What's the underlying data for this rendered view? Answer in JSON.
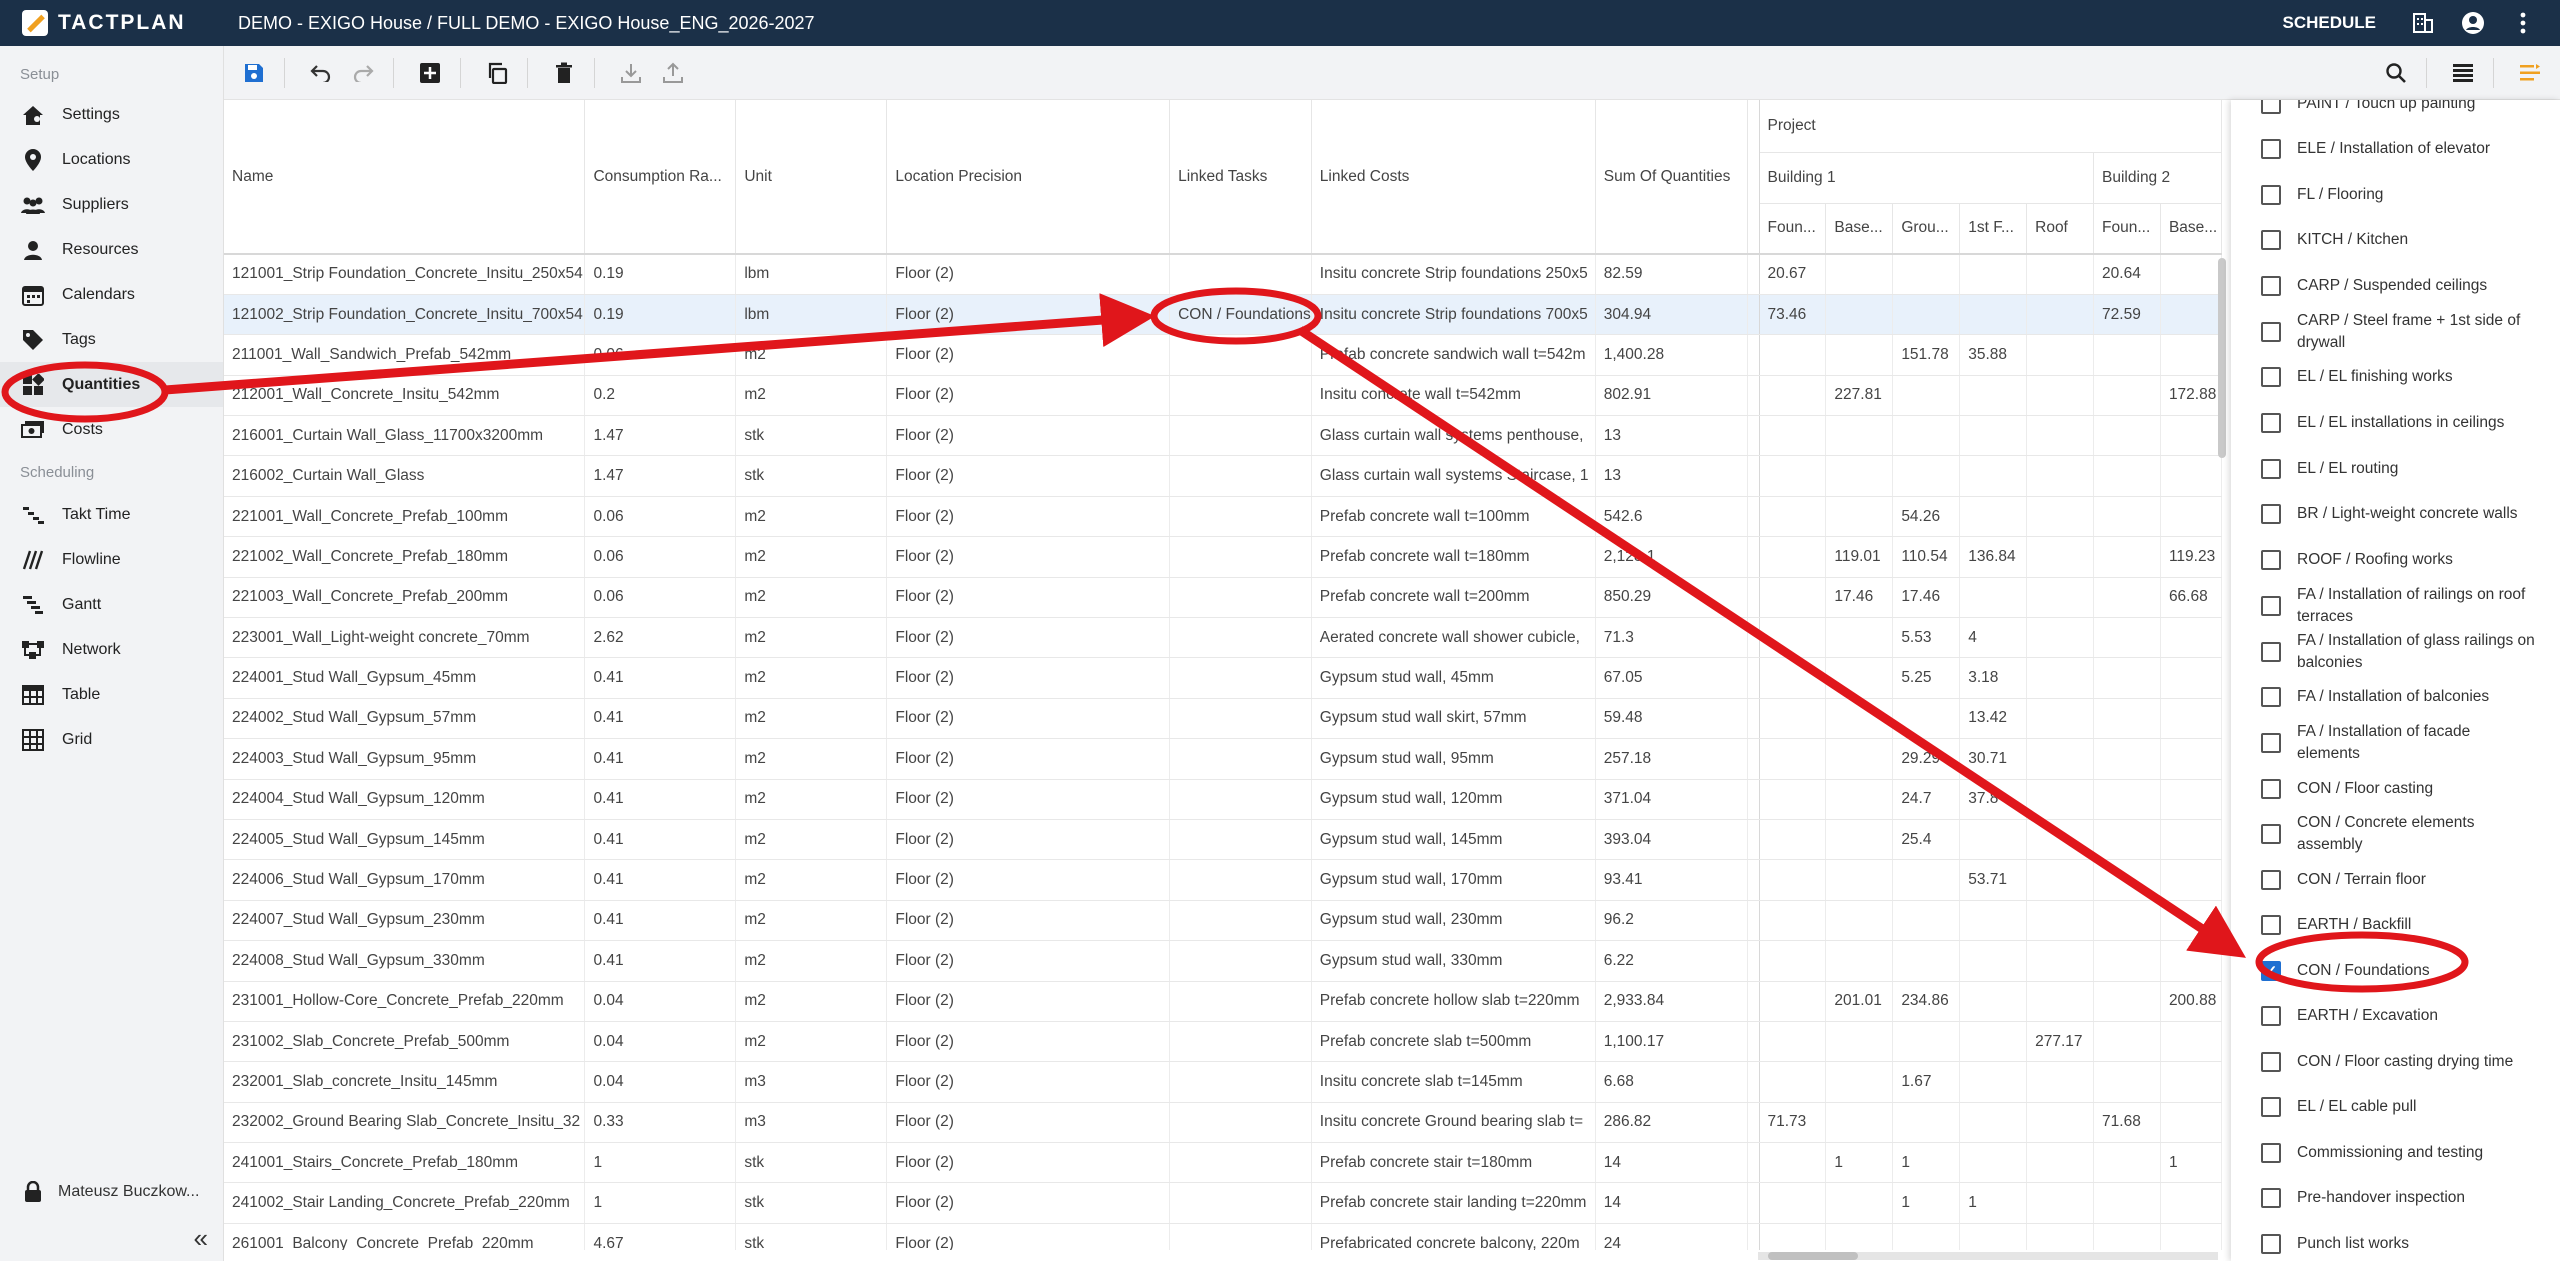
{
  "topbar": {
    "logo_text": "TACTPLAN",
    "project_title": "DEMO - EXIGO House / FULL DEMO - EXIGO House_ENG_2026-2027",
    "schedule_label": "SCHEDULE"
  },
  "sidebar": {
    "setup_label": "Setup",
    "setup_items": [
      {
        "label": "Settings",
        "icon": "home-gear-icon"
      },
      {
        "label": "Locations",
        "icon": "location-pin-icon"
      },
      {
        "label": "Suppliers",
        "icon": "people-icon"
      },
      {
        "label": "Resources",
        "icon": "person-icon"
      },
      {
        "label": "Calendars",
        "icon": "calendar-icon"
      },
      {
        "label": "Tags",
        "icon": "tag-icon"
      },
      {
        "label": "Quantities",
        "icon": "quantities-icon",
        "active": true
      },
      {
        "label": "Costs",
        "icon": "money-icon"
      }
    ],
    "scheduling_label": "Scheduling",
    "scheduling_items": [
      {
        "label": "Takt Time",
        "icon": "takt-icon"
      },
      {
        "label": "Flowline",
        "icon": "flowline-icon"
      },
      {
        "label": "Gantt",
        "icon": "gantt-icon"
      },
      {
        "label": "Network",
        "icon": "network-icon"
      },
      {
        "label": "Table",
        "icon": "table-icon"
      },
      {
        "label": "Grid",
        "icon": "grid-icon"
      }
    ],
    "user_name": "Mateusz Buczkow...",
    "collapse_glyph": "«"
  },
  "table": {
    "headers": {
      "name": "Name",
      "consumption_rate": "Consumption Ra...",
      "unit": "Unit",
      "location_precision": "Location Precision",
      "linked_tasks": "Linked Tasks",
      "linked_costs": "Linked Costs",
      "sum_of_quantities": "Sum Of Quantities",
      "project": "Project",
      "building1": "Building 1",
      "building2": "Building 2",
      "b1_cols": [
        "Foun...",
        "Base...",
        "Grou...",
        "1st F...",
        "Roof"
      ],
      "b2_cols": [
        "Foun...",
        "Base..."
      ]
    },
    "rows": [
      {
        "name": "121001_Strip Foundation_Concrete_Insitu_250x54",
        "rate": "0.19",
        "unit": "lbm",
        "loc": "Floor (2)",
        "tasks": "",
        "costs": "Insitu concrete Strip foundations 250x5",
        "sum": "82.59",
        "b1": [
          "20.67",
          "",
          "",
          "",
          ""
        ],
        "b2": [
          "20.64",
          ""
        ]
      },
      {
        "name": "121002_Strip Foundation_Concrete_Insitu_700x54",
        "rate": "0.19",
        "unit": "lbm",
        "loc": "Floor (2)",
        "tasks": "CON / Foundations",
        "costs": "Insitu concrete Strip foundations 700x5",
        "sum": "304.94",
        "b1": [
          "73.46",
          "",
          "",
          "",
          ""
        ],
        "b2": [
          "72.59",
          ""
        ],
        "selected": true
      },
      {
        "name": "211001_Wall_Sandwich_Prefab_542mm",
        "rate": "0.06",
        "unit": "m2",
        "loc": "Floor (2)",
        "tasks": "",
        "costs": "Prefab concrete sandwich wall t=542m",
        "sum": "1,400.28",
        "b1": [
          "",
          "",
          "151.78",
          "35.88",
          ""
        ],
        "b2": [
          "",
          ""
        ]
      },
      {
        "name": "212001_Wall_Concrete_Insitu_542mm",
        "rate": "0.2",
        "unit": "m2",
        "loc": "Floor (2)",
        "tasks": "",
        "costs": "Insitu concrete wall t=542mm",
        "sum": "802.91",
        "b1": [
          "",
          "227.81",
          "",
          "",
          ""
        ],
        "b2": [
          "",
          "172.88"
        ]
      },
      {
        "name": "216001_Curtain Wall_Glass_11700x3200mm",
        "rate": "1.47",
        "unit": "stk",
        "loc": "Floor (2)",
        "tasks": "",
        "costs": "Glass curtain wall systems penthouse,",
        "sum": "13",
        "b1": [
          "",
          "",
          "",
          "",
          ""
        ],
        "b2": [
          "",
          ""
        ]
      },
      {
        "name": "216002_Curtain Wall_Glass",
        "rate": "1.47",
        "unit": "stk",
        "loc": "Floor (2)",
        "tasks": "",
        "costs": "Glass curtain wall systems Staircase, 1",
        "sum": "13",
        "b1": [
          "",
          "",
          "",
          "",
          ""
        ],
        "b2": [
          "",
          ""
        ]
      },
      {
        "name": "221001_Wall_Concrete_Prefab_100mm",
        "rate": "0.06",
        "unit": "m2",
        "loc": "Floor (2)",
        "tasks": "",
        "costs": "Prefab concrete wall t=100mm",
        "sum": "542.6",
        "b1": [
          "",
          "",
          "54.26",
          "",
          ""
        ],
        "b2": [
          "",
          ""
        ]
      },
      {
        "name": "221002_Wall_Concrete_Prefab_180mm",
        "rate": "0.06",
        "unit": "m2",
        "loc": "Floor (2)",
        "tasks": "",
        "costs": "Prefab concrete wall t=180mm",
        "sum": "2,128.1",
        "b1": [
          "",
          "119.01",
          "110.54",
          "136.84",
          ""
        ],
        "b2": [
          "",
          "119.23"
        ]
      },
      {
        "name": "221003_Wall_Concrete_Prefab_200mm",
        "rate": "0.06",
        "unit": "m2",
        "loc": "Floor (2)",
        "tasks": "",
        "costs": "Prefab concrete wall t=200mm",
        "sum": "850.29",
        "b1": [
          "",
          "17.46",
          "17.46",
          "",
          ""
        ],
        "b2": [
          "",
          "66.68"
        ]
      },
      {
        "name": "223001_Wall_Light-weight concrete_70mm",
        "rate": "2.62",
        "unit": "m2",
        "loc": "Floor (2)",
        "tasks": "",
        "costs": "Aerated concrete wall shower cubicle,",
        "sum": "71.3",
        "b1": [
          "",
          "",
          "5.53",
          "4",
          ""
        ],
        "b2": [
          "",
          ""
        ]
      },
      {
        "name": "224001_Stud Wall_Gypsum_45mm",
        "rate": "0.41",
        "unit": "m2",
        "loc": "Floor (2)",
        "tasks": "",
        "costs": "Gypsum stud wall, 45mm",
        "sum": "67.05",
        "b1": [
          "",
          "",
          "5.25",
          "3.18",
          ""
        ],
        "b2": [
          "",
          ""
        ]
      },
      {
        "name": "224002_Stud Wall_Gypsum_57mm",
        "rate": "0.41",
        "unit": "m2",
        "loc": "Floor (2)",
        "tasks": "",
        "costs": "Gypsum stud wall skirt, 57mm",
        "sum": "59.48",
        "b1": [
          "",
          "",
          "",
          "13.42",
          ""
        ],
        "b2": [
          "",
          ""
        ]
      },
      {
        "name": "224003_Stud Wall_Gypsum_95mm",
        "rate": "0.41",
        "unit": "m2",
        "loc": "Floor (2)",
        "tasks": "",
        "costs": "Gypsum stud wall, 95mm",
        "sum": "257.18",
        "b1": [
          "",
          "",
          "29.29",
          "30.71",
          ""
        ],
        "b2": [
          "",
          ""
        ]
      },
      {
        "name": "224004_Stud Wall_Gypsum_120mm",
        "rate": "0.41",
        "unit": "m2",
        "loc": "Floor (2)",
        "tasks": "",
        "costs": "Gypsum stud wall, 120mm",
        "sum": "371.04",
        "b1": [
          "",
          "",
          "24.7",
          "37.8",
          ""
        ],
        "b2": [
          "",
          ""
        ]
      },
      {
        "name": "224005_Stud Wall_Gypsum_145mm",
        "rate": "0.41",
        "unit": "m2",
        "loc": "Floor (2)",
        "tasks": "",
        "costs": "Gypsum stud wall, 145mm",
        "sum": "393.04",
        "b1": [
          "",
          "",
          "25.4",
          "",
          ""
        ],
        "b2": [
          "",
          ""
        ]
      },
      {
        "name": "224006_Stud Wall_Gypsum_170mm",
        "rate": "0.41",
        "unit": "m2",
        "loc": "Floor (2)",
        "tasks": "",
        "costs": "Gypsum stud wall, 170mm",
        "sum": "93.41",
        "b1": [
          "",
          "",
          "",
          "53.71",
          ""
        ],
        "b2": [
          "",
          ""
        ]
      },
      {
        "name": "224007_Stud Wall_Gypsum_230mm",
        "rate": "0.41",
        "unit": "m2",
        "loc": "Floor (2)",
        "tasks": "",
        "costs": "Gypsum stud wall, 230mm",
        "sum": "96.2",
        "b1": [
          "",
          "",
          "",
          "",
          ""
        ],
        "b2": [
          "",
          ""
        ]
      },
      {
        "name": "224008_Stud Wall_Gypsum_330mm",
        "rate": "0.41",
        "unit": "m2",
        "loc": "Floor (2)",
        "tasks": "",
        "costs": "Gypsum stud wall, 330mm",
        "sum": "6.22",
        "b1": [
          "",
          "",
          "",
          "",
          ""
        ],
        "b2": [
          "",
          ""
        ]
      },
      {
        "name": "231001_Hollow-Core_Concrete_Prefab_220mm",
        "rate": "0.04",
        "unit": "m2",
        "loc": "Floor (2)",
        "tasks": "",
        "costs": "Prefab concrete hollow slab t=220mm",
        "sum": "2,933.84",
        "b1": [
          "",
          "201.01",
          "234.86",
          "",
          ""
        ],
        "b2": [
          "",
          "200.88"
        ]
      },
      {
        "name": "231002_Slab_Concrete_Prefab_500mm",
        "rate": "0.04",
        "unit": "m2",
        "loc": "Floor (2)",
        "tasks": "",
        "costs": "Prefab concrete slab t=500mm",
        "sum": "1,100.17",
        "b1": [
          "",
          "",
          "",
          "",
          "277.17"
        ],
        "b2": [
          "",
          ""
        ]
      },
      {
        "name": "232001_Slab_concrete_Insitu_145mm",
        "rate": "0.04",
        "unit": "m3",
        "loc": "Floor (2)",
        "tasks": "",
        "costs": "Insitu concrete slab t=145mm",
        "sum": "6.68",
        "b1": [
          "",
          "",
          "1.67",
          "",
          ""
        ],
        "b2": [
          "",
          ""
        ]
      },
      {
        "name": "232002_Ground Bearing Slab_Concrete_Insitu_32",
        "rate": "0.33",
        "unit": "m3",
        "loc": "Floor (2)",
        "tasks": "",
        "costs": "Insitu concrete Ground bearing slab t=",
        "sum": "286.82",
        "b1": [
          "71.73",
          "",
          "",
          "",
          ""
        ],
        "b2": [
          "71.68",
          ""
        ]
      },
      {
        "name": "241001_Stairs_Concrete_Prefab_180mm",
        "rate": "1",
        "unit": "stk",
        "loc": "Floor (2)",
        "tasks": "",
        "costs": "Prefab concrete stair t=180mm",
        "sum": "14",
        "b1": [
          "",
          "1",
          "1",
          "",
          ""
        ],
        "b2": [
          "",
          "1"
        ]
      },
      {
        "name": "241002_Stair Landing_Concrete_Prefab_220mm",
        "rate": "1",
        "unit": "stk",
        "loc": "Floor (2)",
        "tasks": "",
        "costs": "Prefab concrete stair landing t=220mm",
        "sum": "14",
        "b1": [
          "",
          "",
          "1",
          "1",
          ""
        ],
        "b2": [
          "",
          ""
        ]
      },
      {
        "name": "261001_Balcony_Concrete_Prefab_220mm",
        "rate": "4.67",
        "unit": "stk",
        "loc": "Floor (2)",
        "tasks": "",
        "costs": "Prefabricated concrete balcony, 220m",
        "sum": "24",
        "b1": [
          "",
          "",
          "",
          "",
          ""
        ],
        "b2": [
          "",
          ""
        ]
      }
    ]
  },
  "task_filter": {
    "items": [
      {
        "label": "PAINT / Touch up painting",
        "checked": false
      },
      {
        "label": "ELE / Installation of elevator",
        "checked": false
      },
      {
        "label": "FL / Flooring",
        "checked": false
      },
      {
        "label": "KITCH / Kitchen",
        "checked": false
      },
      {
        "label": "CARP / Suspended ceilings",
        "checked": false
      },
      {
        "label": "CARP / Steel frame + 1st side of drywall",
        "checked": false
      },
      {
        "label": "EL / EL finishing works",
        "checked": false
      },
      {
        "label": "EL / EL installations in ceilings",
        "checked": false
      },
      {
        "label": "EL / EL routing",
        "checked": false
      },
      {
        "label": "BR / Light-weight concrete walls",
        "checked": false
      },
      {
        "label": "ROOF / Roofing works",
        "checked": false
      },
      {
        "label": "FA / Installation of railings on roof terraces",
        "checked": false
      },
      {
        "label": "FA / Installation of glass railings on balconies",
        "checked": false
      },
      {
        "label": "FA / Installation of balconies",
        "checked": false
      },
      {
        "label": "FA / Installation of facade elements",
        "checked": false
      },
      {
        "label": "CON / Floor casting",
        "checked": false
      },
      {
        "label": "CON / Concrete elements assembly",
        "checked": false
      },
      {
        "label": "CON / Terrain floor",
        "checked": false
      },
      {
        "label": "EARTH / Backfill",
        "checked": false
      },
      {
        "label": "CON / Foundations",
        "checked": true
      },
      {
        "label": "EARTH / Excavation",
        "checked": false
      },
      {
        "label": "CON / Floor casting drying time",
        "checked": false
      },
      {
        "label": "EL / EL cable pull",
        "checked": false
      },
      {
        "label": "Commissioning and testing",
        "checked": false
      },
      {
        "label": "Pre-handover inspection",
        "checked": false
      },
      {
        "label": "Punch list works",
        "checked": false
      }
    ]
  },
  "colors": {
    "topbar": "#1b3048",
    "annotation_red": "#e0161b",
    "checkbox_blue": "#1f6fd1",
    "accent_orange": "#f0a020"
  }
}
